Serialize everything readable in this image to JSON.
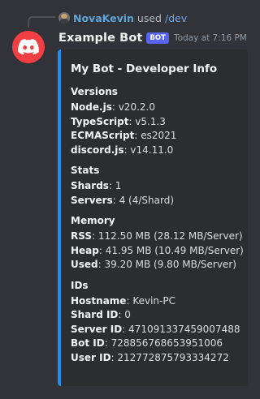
{
  "reply": {
    "username": "NovaKevin",
    "used_text": "used",
    "command": "/dev"
  },
  "message": {
    "bot_name": "Example Bot",
    "bot_tag": "BOT",
    "timestamp": "Today at 7:16 PM"
  },
  "embed": {
    "accent_color": "#1e8ef2",
    "title": "My Bot - Developer Info",
    "sections": [
      {
        "name": "Versions",
        "lines": [
          {
            "key": "Node.js",
            "value": "v20.2.0"
          },
          {
            "key": "TypeScript",
            "value": "v5.1.3"
          },
          {
            "key": "ECMAScript",
            "value": "es2021"
          },
          {
            "key": "discord.js",
            "value": "v14.11.0"
          }
        ]
      },
      {
        "name": "Stats",
        "lines": [
          {
            "key": "Shards",
            "value": "1"
          },
          {
            "key": "Servers",
            "value": "4 (4/Shard)"
          }
        ]
      },
      {
        "name": "Memory",
        "lines": [
          {
            "key": "RSS",
            "value": "112.50 MB (28.12 MB/Server)"
          },
          {
            "key": "Heap",
            "value": "41.95 MB (10.49 MB/Server)"
          },
          {
            "key": "Used",
            "value": "39.20 MB (9.80 MB/Server)"
          }
        ]
      },
      {
        "name": "IDs",
        "lines": [
          {
            "key": "Hostname",
            "value": "Kevin-PC"
          },
          {
            "key": "Shard ID",
            "value": "0"
          },
          {
            "key": "Server ID",
            "value": "471091337459007488"
          },
          {
            "key": "Bot ID",
            "value": "728856768653951006"
          },
          {
            "key": "User ID",
            "value": "212772875793334272"
          }
        ]
      }
    ]
  },
  "colors": {
    "background": "#313338",
    "avatar": "#f23f43",
    "bot_tag": "#5865f2",
    "username": "#5ea2d6"
  },
  "icons": {
    "avatar_icon": "discord-logo-icon",
    "reply_avatar": "user-avatar-icon"
  }
}
